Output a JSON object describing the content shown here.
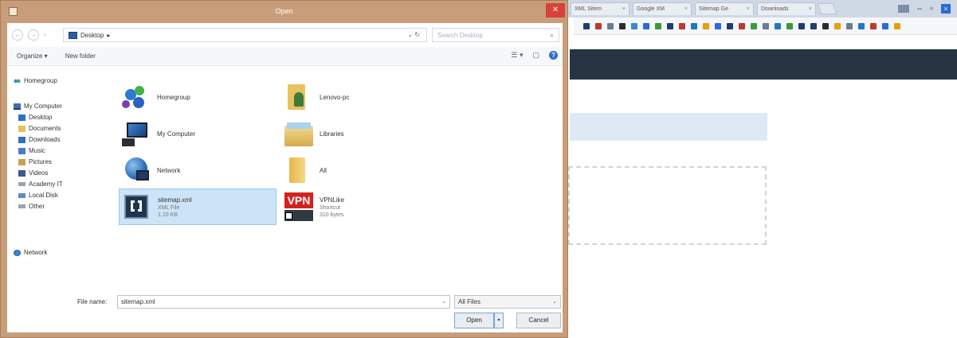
{
  "browser": {
    "tabs": [
      {
        "label": "XML Sitem"
      },
      {
        "label": "Google XM"
      },
      {
        "label": "Sitemap Ge"
      },
      {
        "label": "Downloads"
      }
    ],
    "bookmark_colors": [
      "#1f3d6e",
      "#c0392b",
      "#6b7c93",
      "#2c2c2c",
      "#3b88d8",
      "#2b6ad8",
      "#3c9a3c",
      "#1f3d6e",
      "#c0392b",
      "#1f78c4",
      "#e4a011",
      "#2b6ad8",
      "#1f3d6e",
      "#c0392b",
      "#3c9a3c",
      "#6b7c93",
      "#1f78c4",
      "#3c9a3c",
      "#1f3d6e",
      "#1f3d6e",
      "#2c2c2c",
      "#e4a011",
      "#6b7c93",
      "#1f78c4",
      "#c0392b",
      "#2b6ad8",
      "#e4a011"
    ]
  },
  "dialog": {
    "title": "Open",
    "close_glyph": "✕",
    "address": {
      "back_glyph": "←",
      "forward_glyph": "→",
      "up_glyph": "↑",
      "location": "Desktop",
      "chevron": "▸",
      "dropdown": "⌄",
      "refresh": "↻",
      "search_placeholder": "Search Desktop",
      "search_icon": "⌕"
    },
    "toolbar": {
      "organize": "Organize ▾",
      "new_folder": "New folder",
      "view_glyph": "☰ ▾",
      "pane_glyph": "▢",
      "help_glyph": "?"
    },
    "nav": [
      {
        "label": "Homegroup",
        "icon": "group"
      },
      {
        "label": "My Computer",
        "icon": "comp"
      },
      {
        "label": "Desktop",
        "icon": "blue"
      },
      {
        "label": "Documents",
        "icon": "folder"
      },
      {
        "label": "Downloads",
        "icon": "blue"
      },
      {
        "label": "Music",
        "icon": "music"
      },
      {
        "label": "Pictures",
        "icon": "pics"
      },
      {
        "label": "Videos",
        "icon": "video"
      },
      {
        "label": "Academy IT",
        "icon": "drive"
      },
      {
        "label": "Local Disk",
        "icon": "local"
      },
      {
        "label": "Other",
        "icon": "drive"
      },
      {
        "label": "Network",
        "icon": "net"
      }
    ],
    "files": [
      {
        "name": "Homegroup",
        "sub": "",
        "sub2": ""
      },
      {
        "name": "Lenovo-pc",
        "sub": "",
        "sub2": ""
      },
      {
        "name": "My Computer",
        "sub": "",
        "sub2": ""
      },
      {
        "name": "Libraries",
        "sub": "",
        "sub2": ""
      },
      {
        "name": "Network",
        "sub": "",
        "sub2": ""
      },
      {
        "name": "All",
        "sub": "",
        "sub2": ""
      },
      {
        "name": "sitemap.xml",
        "sub": "XML File",
        "sub2": "1.10 KB"
      },
      {
        "name": "VPNLike",
        "sub": "Shortcut",
        "sub2": "310 bytes"
      }
    ],
    "vpn_label": "VPN",
    "bottom": {
      "file_name_label": "File name:",
      "file_name_value": "sitemap.xml",
      "file_type": "All Files",
      "dropdown_glyph": "⌄",
      "open": "Open",
      "split_glyph": "▾",
      "cancel": "Cancel"
    }
  }
}
